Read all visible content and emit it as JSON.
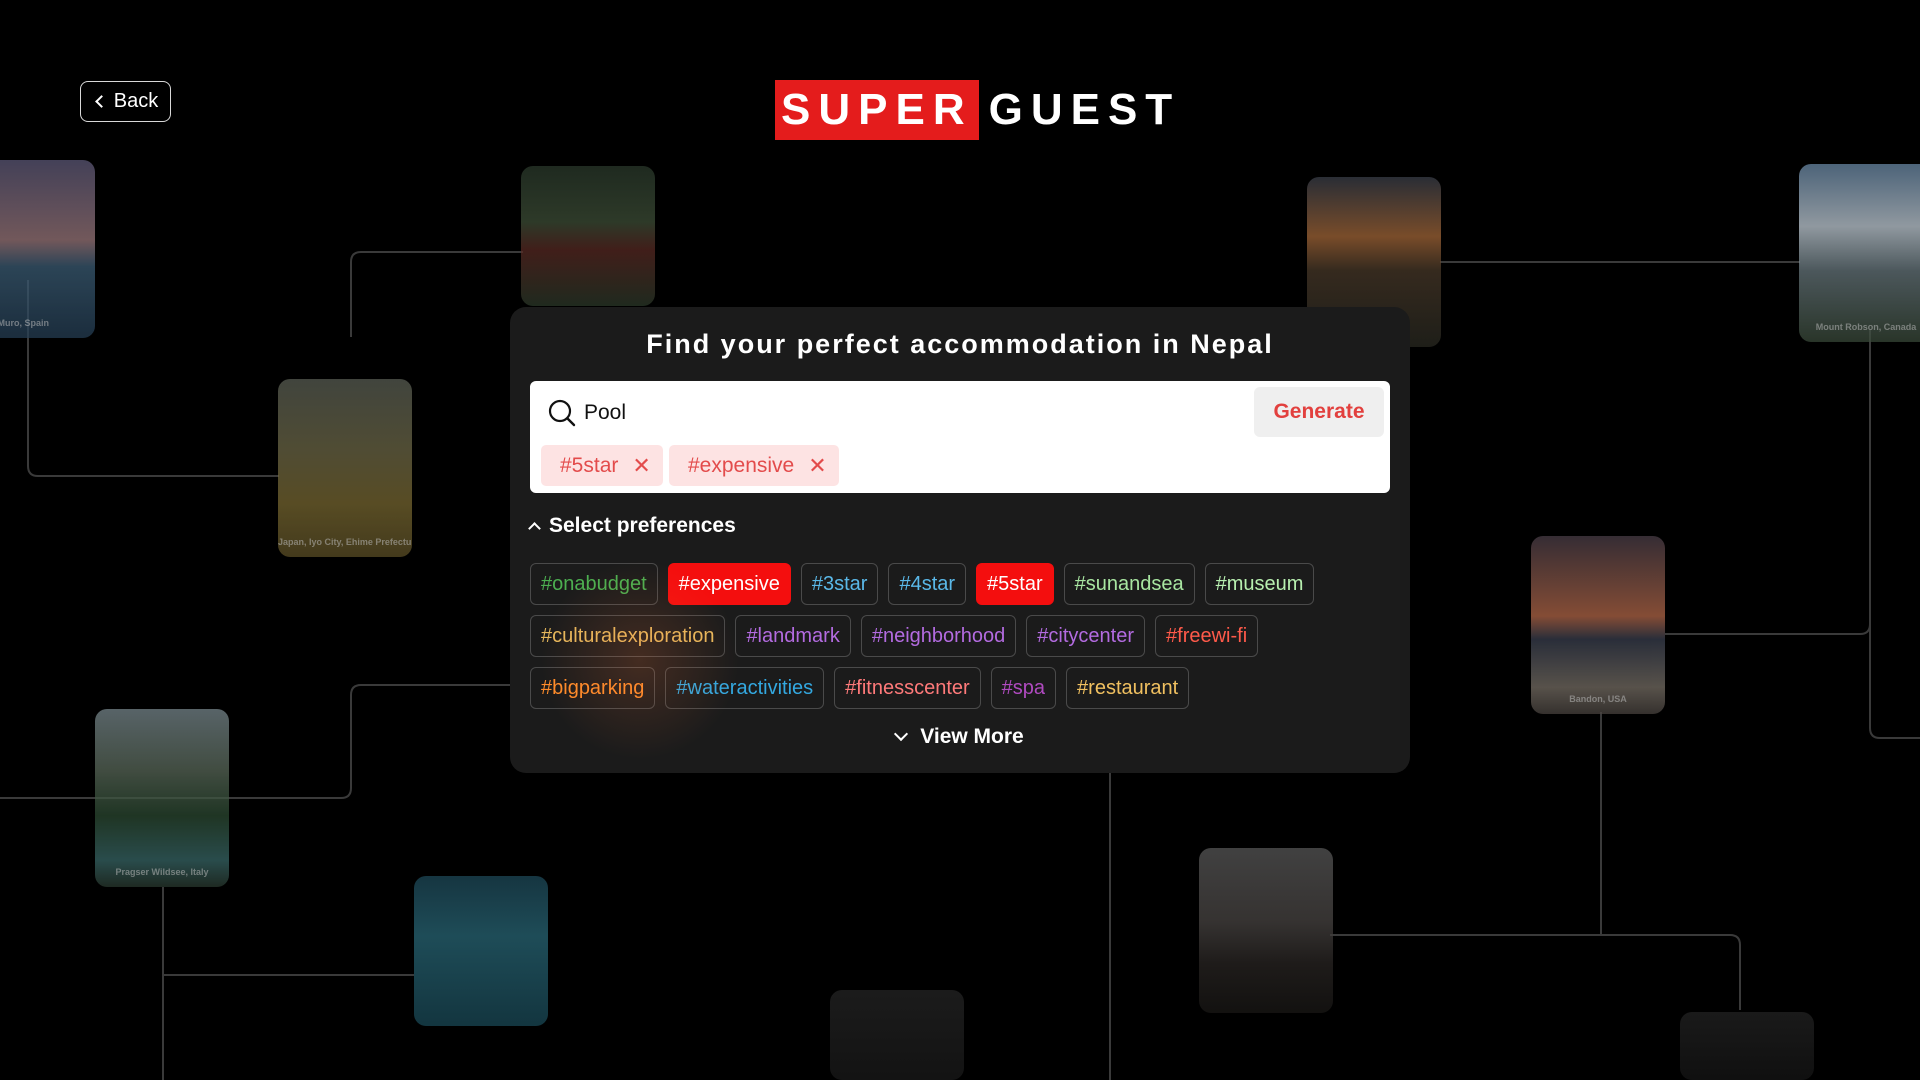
{
  "header": {
    "back_label": "Back",
    "logo_super": "SUPER",
    "logo_guest": "GUEST"
  },
  "background_cards": [
    {
      "caption": "a de Muro, Spain"
    },
    {
      "caption": "Japan, Iyo City, Ehime Prefecture"
    },
    {
      "caption": ""
    },
    {
      "caption": ""
    },
    {
      "caption": "Mount Robson, Canada"
    },
    {
      "caption": "Bandon, USA"
    },
    {
      "caption": "Pragser Wildsee, Italy"
    },
    {
      "caption": ""
    },
    {
      "caption": ""
    }
  ],
  "search": {
    "title": "Find your perfect accommodation in Nepal",
    "query": "Pool",
    "generate_label": "Generate",
    "selected_tags": [
      "#5star",
      "#expensive"
    ],
    "remove_symbol": "✕"
  },
  "preferences": {
    "header_label": "Select preferences",
    "view_more_label": "View More",
    "rows": [
      [
        {
          "label": "#onabudget",
          "color": "#4caf50",
          "active": false
        },
        {
          "label": "#expensive",
          "color": "#ffffff",
          "active": true
        },
        {
          "label": "#3star",
          "color": "#5ab8e8",
          "active": false
        },
        {
          "label": "#4star",
          "color": "#5ab8e8",
          "active": false
        },
        {
          "label": "#5star",
          "color": "#ffffff",
          "active": true
        },
        {
          "label": "#sunandsea",
          "color": "#a8e6a1",
          "active": false
        },
        {
          "label": "#museum",
          "color": "#b8f0b0",
          "active": false
        }
      ],
      [
        {
          "label": "#culturalexploration",
          "color": "#e6b85c",
          "active": false
        },
        {
          "label": "#landmark",
          "color": "#b36be0",
          "active": false
        },
        {
          "label": "#neighborhood",
          "color": "#b36be0",
          "active": false
        },
        {
          "label": "#citycenter",
          "color": "#b36be0",
          "active": false
        },
        {
          "label": "#freewi-fi",
          "color": "#ff5a4a",
          "active": false
        }
      ],
      [
        {
          "label": "#bigparking",
          "color": "#ff8c2a",
          "active": false
        },
        {
          "label": "#wateractivities",
          "color": "#33a8e0",
          "active": false
        },
        {
          "label": "#fitnesscenter",
          "color": "#ff7a7a",
          "active": false
        },
        {
          "label": "#spa",
          "color": "#b04ac0",
          "active": false
        },
        {
          "label": "#restaurant",
          "color": "#f0c060",
          "active": false
        }
      ]
    ]
  }
}
